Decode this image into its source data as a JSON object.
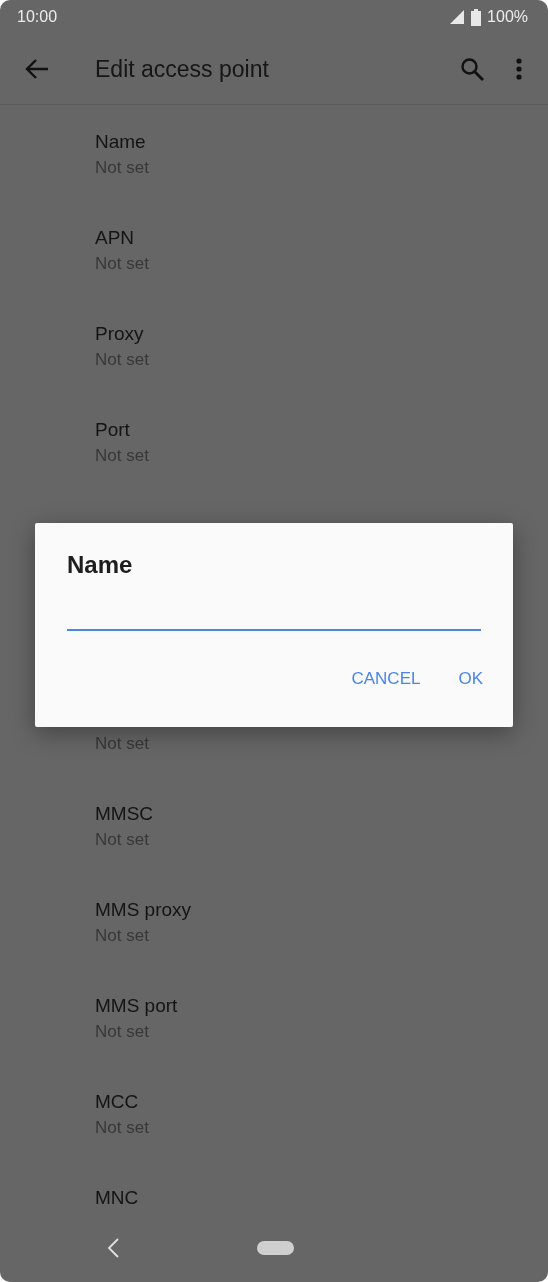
{
  "status_bar": {
    "time": "10:00",
    "battery": "100%"
  },
  "app_bar": {
    "title": "Edit access point"
  },
  "settings": [
    {
      "title": "Name",
      "value": "Not set"
    },
    {
      "title": "APN",
      "value": "Not set"
    },
    {
      "title": "Proxy",
      "value": "Not set"
    },
    {
      "title": "Port",
      "value": "Not set"
    },
    {
      "value": "Not set"
    },
    {
      "title": "MMSC",
      "value": "Not set"
    },
    {
      "title": "MMS proxy",
      "value": "Not set"
    },
    {
      "title": "MMS port",
      "value": "Not set"
    },
    {
      "title": "MCC",
      "value": "Not set"
    },
    {
      "title": "MNC"
    }
  ],
  "dialog": {
    "title": "Name",
    "buttons": [
      "CANCEL",
      "OK"
    ]
  }
}
